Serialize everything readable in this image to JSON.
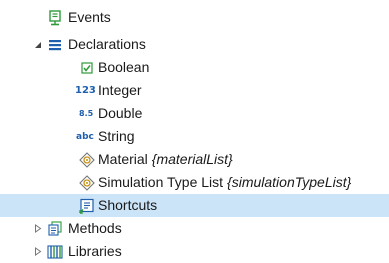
{
  "tree": {
    "events": {
      "label": "Events",
      "icon": "events-icon"
    },
    "declarations": {
      "label": "Declarations",
      "icon": "declarations-list-icon",
      "expanded": true,
      "children": {
        "boolean": {
          "label": "Boolean",
          "icon": "boolean-checkbox-icon"
        },
        "integer": {
          "label": "Integer",
          "icon": "integer-123-icon",
          "icon_text": "123"
        },
        "double": {
          "label": "Double",
          "icon": "double-8.5-icon",
          "icon_text": "8.5"
        },
        "string": {
          "label": "String",
          "icon": "string-abc-icon",
          "icon_text": "abc"
        },
        "material": {
          "label": "Material",
          "sub": "{materialList}",
          "icon": "choice-list-icon"
        },
        "simulation_type_list": {
          "label": "Simulation Type List",
          "sub": "{simulationTypeList}",
          "icon": "choice-list-icon"
        },
        "shortcuts": {
          "label": "Shortcuts",
          "icon": "shortcut-icon",
          "selected": true
        }
      }
    },
    "methods": {
      "label": "Methods",
      "icon": "methods-icon",
      "expanded": false
    },
    "libraries": {
      "label": "Libraries",
      "icon": "libraries-icon",
      "expanded": false
    }
  },
  "colors": {
    "selection": "#cce4f7",
    "icon_blue": "#1f5fad",
    "icon_green": "#2e9a3b",
    "icon_gold": "#c69214",
    "text": "#1a1a1a"
  }
}
